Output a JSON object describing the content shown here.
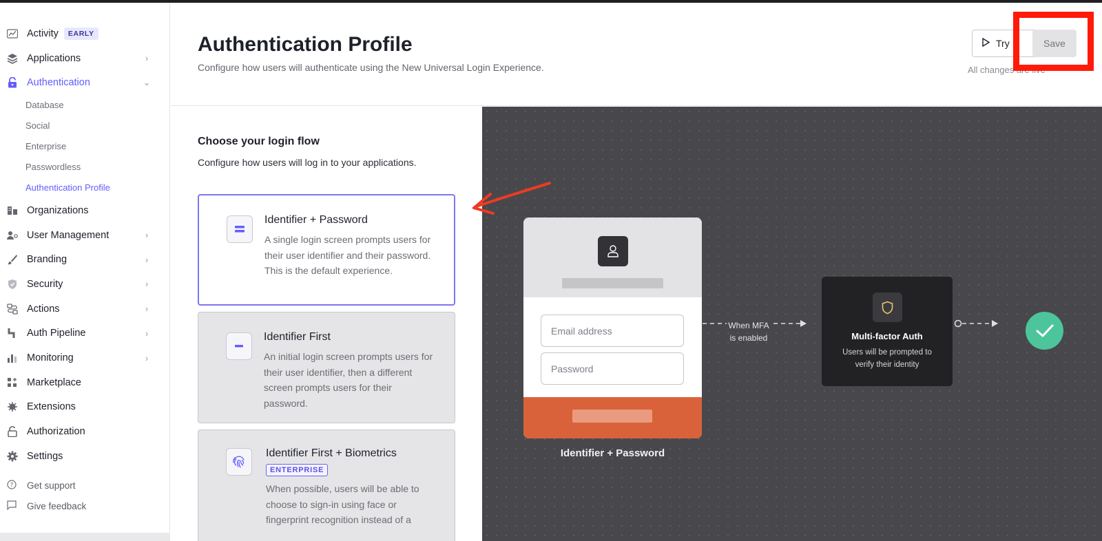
{
  "sidebar": {
    "items": [
      {
        "label": "Activity",
        "badge": "EARLY",
        "icon": "activity-icon"
      },
      {
        "label": "Applications",
        "icon": "applications-icon",
        "chevron": "right"
      },
      {
        "label": "Authentication",
        "icon": "lock-icon",
        "chevron": "down"
      },
      {
        "label": "Organizations",
        "icon": "organizations-icon"
      },
      {
        "label": "User Management",
        "icon": "user-management-icon",
        "chevron": "right"
      },
      {
        "label": "Branding",
        "icon": "brush-icon",
        "chevron": "right"
      },
      {
        "label": "Security",
        "icon": "shield-icon",
        "chevron": "right"
      },
      {
        "label": "Actions",
        "icon": "actions-icon",
        "chevron": "right"
      },
      {
        "label": "Auth Pipeline",
        "icon": "pipeline-icon",
        "chevron": "right"
      },
      {
        "label": "Monitoring",
        "icon": "monitoring-icon",
        "chevron": "right"
      },
      {
        "label": "Marketplace",
        "icon": "marketplace-icon"
      },
      {
        "label": "Extensions",
        "icon": "extensions-icon"
      },
      {
        "label": "Authorization",
        "icon": "unlock-icon"
      },
      {
        "label": "Settings",
        "icon": "gear-icon"
      }
    ],
    "authentication_sub": [
      "Database",
      "Social",
      "Enterprise",
      "Passwordless",
      "Authentication Profile"
    ],
    "footer": [
      {
        "label": "Get support",
        "icon": "help-circle-icon"
      },
      {
        "label": "Give feedback",
        "icon": "message-icon"
      }
    ]
  },
  "header": {
    "title": "Authentication Profile",
    "subtitle": "Configure how users will authenticate using the New Universal Login Experience.",
    "try_label": "Try",
    "save_label": "Save",
    "live_text": "All changes are live"
  },
  "login_flow": {
    "title": "Choose your login flow",
    "subtitle": "Configure how users will log in to your applications.",
    "options": [
      {
        "title": "Identifier + Password",
        "description": "A single login screen prompts users for their user identifier and their password. This is the default experience.",
        "selected": true
      },
      {
        "title": "Identifier First",
        "description": "An initial login screen prompts users for their user identifier, then a different screen prompts users for their password.",
        "selected": false
      },
      {
        "title": "Identifier First + Biometrics",
        "badge": "ENTERPRISE",
        "description": "When possible, users will be able to choose to sign-in using face or fingerprint recognition instead of a",
        "selected": false
      }
    ]
  },
  "preview": {
    "email_placeholder": "Email address",
    "password_placeholder": "Password",
    "caption": "Identifier + Password",
    "mfa_condition_line1": "When MFA",
    "mfa_condition_line2": "is enabled",
    "mfa_title": "Multi-factor Auth",
    "mfa_description": "Users will be prompted to verify their identity"
  },
  "colors": {
    "accent": "#635dff",
    "annotation_red": "#ff1a0a",
    "preview_bg": "#48484c",
    "login_button": "#d9623a",
    "success": "#4dc59c"
  }
}
